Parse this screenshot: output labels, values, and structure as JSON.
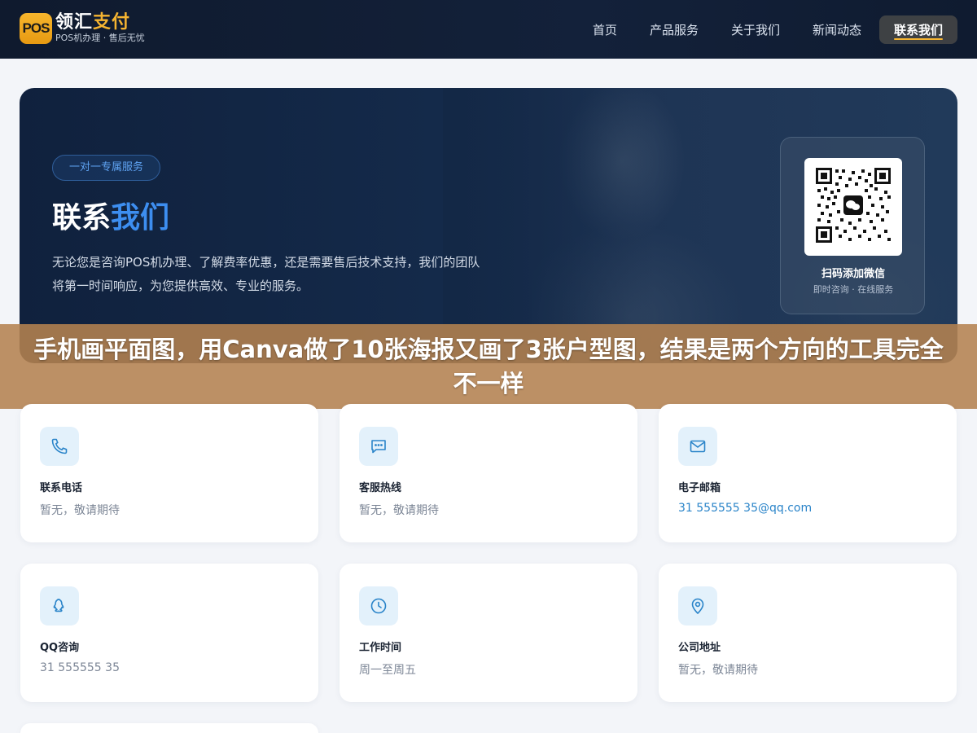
{
  "brand": {
    "badge": "POS",
    "title_part1": "领汇",
    "title_part2": "支付",
    "subtitle": "POS机办理 · 售后无忧"
  },
  "nav": {
    "items": [
      {
        "label": "首页"
      },
      {
        "label": "产品服务"
      },
      {
        "label": "关于我们"
      },
      {
        "label": "新闻动态"
      },
      {
        "label": "联系我们",
        "active": true
      }
    ],
    "accent_color": "#f5b431"
  },
  "hero": {
    "tag": "一对一专属服务",
    "title_part1": "联系",
    "title_part2": "我们",
    "description": "无论您是咨询POS机办理、了解费率优惠，还是需要售后技术支持，我们的团队将第一时间响应，为您提供高效、专业的服务。",
    "qr": {
      "label": "扫码添加微信",
      "sub": "即时咨询 · 在线服务",
      "icon": "wechat-icon"
    }
  },
  "banner": {
    "text": "手机画平面图，用Canva做了10张海报又画了3张户型图，结果是两个方向的工具完全不一样"
  },
  "contacts": [
    {
      "icon": "phone-icon",
      "title": "联系电话",
      "value": "暂无，敬请期待"
    },
    {
      "icon": "chat-icon",
      "title": "客服热线",
      "value": "暂无，敬请期待"
    },
    {
      "icon": "mail-icon",
      "title": "电子邮箱",
      "value": "31 555555 35@qq.com",
      "link": true
    },
    {
      "icon": "qq-icon",
      "title": "QQ咨询",
      "value": "31 555555 35"
    },
    {
      "icon": "clock-icon",
      "title": "工作时间",
      "value": "周一至周五"
    },
    {
      "icon": "location-icon",
      "title": "公司地址",
      "value": "暂无，敬请期待"
    }
  ],
  "colors": {
    "header_bg": "#111d33",
    "primary_blue": "#3d8ef0",
    "icon_blue": "#2a84c9",
    "icon_bg": "#e3f1fb",
    "banner_bg": "#b48250"
  }
}
